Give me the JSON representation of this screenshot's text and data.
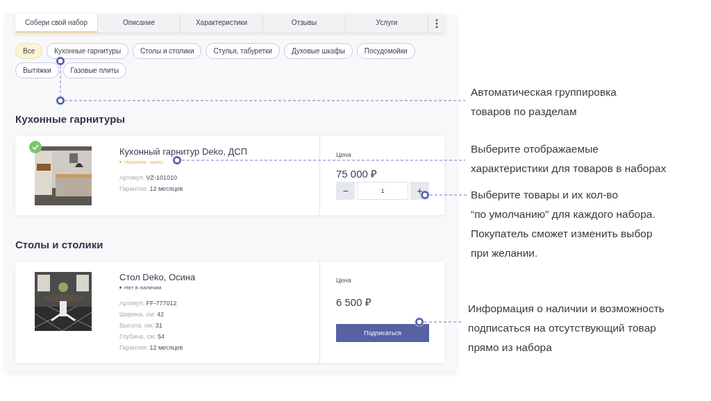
{
  "tabs": [
    {
      "label": "Собери свой набор",
      "selected": true
    },
    {
      "label": "Описание",
      "selected": false
    },
    {
      "label": "Характеристики",
      "selected": false
    },
    {
      "label": "Отзывы",
      "selected": false
    },
    {
      "label": "Услуги",
      "selected": false
    }
  ],
  "filters": [
    {
      "label": "Все",
      "selected": true
    },
    {
      "label": "Кухонные гарнитуры",
      "selected": false
    },
    {
      "label": "Столы и столики",
      "selected": false
    },
    {
      "label": "Стулья, табуретки",
      "selected": false
    },
    {
      "label": "Духовые шкафы",
      "selected": false
    },
    {
      "label": "Посудомойки",
      "selected": false
    },
    {
      "label": "Вытяжки",
      "selected": false
    },
    {
      "label": "Газовые плиты",
      "selected": false
    }
  ],
  "sections": [
    {
      "title": "Кухонные гарнитуры",
      "products": [
        {
          "name": "Кухонный гарнитур Deko, ДСП",
          "selected": true,
          "stock": {
            "kind": "low",
            "label": "Наличие: мало"
          },
          "specs": [
            {
              "label": "Артикул:",
              "value": "VZ-101010"
            },
            {
              "label": "Гарантия:",
              "value": "12 месяцев"
            }
          ],
          "price_label": "Цена",
          "price": "75 000 ₽",
          "action": {
            "kind": "quantity",
            "minus": "−",
            "value": "1",
            "plus": "+"
          }
        }
      ]
    },
    {
      "title": "Столы и столики",
      "products": [
        {
          "name": "Стол Deko, Осина",
          "selected": false,
          "stock": {
            "kind": "none",
            "label": "Нет в наличии"
          },
          "specs": [
            {
              "label": "Артикул:",
              "value": "FF-777012"
            },
            {
              "label": "Ширина, см:",
              "value": "42"
            },
            {
              "label": "Высота, см:",
              "value": "31"
            },
            {
              "label": "Глубина, см:",
              "value": "54"
            },
            {
              "label": "Гарантия:",
              "value": "12 месяцев"
            }
          ],
          "price_label": "Цена",
          "price": "6 500 ₽",
          "action": {
            "kind": "subscribe",
            "label": "Подписаться"
          }
        }
      ]
    }
  ],
  "notes": [
    "Автоматическая группировка\nтоваров по разделам",
    "Выберите отображаемые\nхарактеристики для товаров в наборах",
    "Выберите товары и их кол-во\n“по умолчанию” для каждого набора.\nПокупатель сможет изменить выбор\nпри желании.",
    "Информация о наличии и возможность\nподписаться на отсутствующий товар\nпрямо из набора"
  ]
}
